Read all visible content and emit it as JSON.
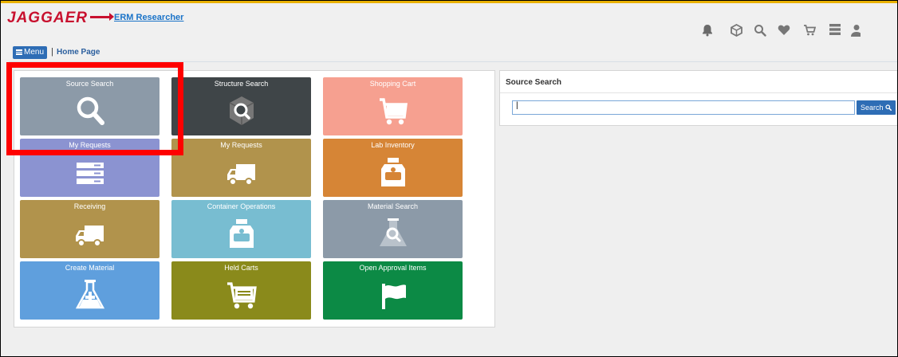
{
  "header": {
    "logo_text": "JAGGAER",
    "app_name": "ERM Researcher",
    "menu_label": "Menu",
    "breadcrumb_sep": "|",
    "breadcrumb": "Home Page"
  },
  "toolbar": {
    "icons": [
      "bell-icon",
      "cube-icon",
      "search-icon",
      "heart-icon",
      "cart-icon",
      "list-icon",
      "user-icon"
    ]
  },
  "tiles": [
    {
      "label": "Source Search",
      "icon": "magnifier-icon",
      "color": "#8c9aa8"
    },
    {
      "label": "Structure Search",
      "icon": "molecule-search-icon",
      "color": "#3f4548"
    },
    {
      "label": "Shopping Cart",
      "icon": "cart-icon",
      "color": "#f6a090"
    },
    {
      "label": "My Requests",
      "icon": "server-list-icon",
      "color": "#8b93d1"
    },
    {
      "label": "My Requests",
      "icon": "truck-icon",
      "color": "#b1934c"
    },
    {
      "label": "Lab Inventory",
      "icon": "bottle-icon",
      "color": "#d68536"
    },
    {
      "label": "Receiving",
      "icon": "truck-icon",
      "color": "#b1934c"
    },
    {
      "label": "Container Operations",
      "icon": "bottle-icon",
      "color": "#78bdd1"
    },
    {
      "label": "Material Search",
      "icon": "flask-search-icon",
      "color": "#8c9aa8"
    },
    {
      "label": "Create Material",
      "icon": "flask-plus-icon",
      "color": "#5f9fdd"
    },
    {
      "label": "Held Carts",
      "icon": "cart-list-icon",
      "color": "#8a8a1b"
    },
    {
      "label": "Open Approval Items",
      "icon": "flag-icon",
      "color": "#0c8a45"
    }
  ],
  "source_search": {
    "title": "Source Search",
    "input_value": "|",
    "button_label": "Search"
  }
}
